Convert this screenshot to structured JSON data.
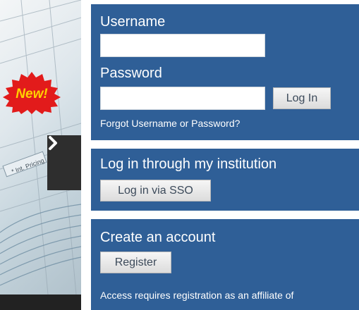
{
  "banner": {
    "badge_text": "New!",
    "next_icon": "chevron-right-icon"
  },
  "login": {
    "username_label": "Username",
    "username_value": "",
    "password_label": "Password",
    "password_value": "",
    "login_button": "Log In",
    "forgot_link": "Forgot Username or Password?"
  },
  "institution": {
    "heading": "Log in through my institution",
    "sso_button": "Log in via SSO"
  },
  "register": {
    "heading": "Create an account",
    "register_button": "Register",
    "note": "Access requires registration as an affiliate of"
  },
  "colors": {
    "panel": "#2f5f97",
    "badge": "#e21b1b",
    "badge_text": "#ffd200"
  }
}
